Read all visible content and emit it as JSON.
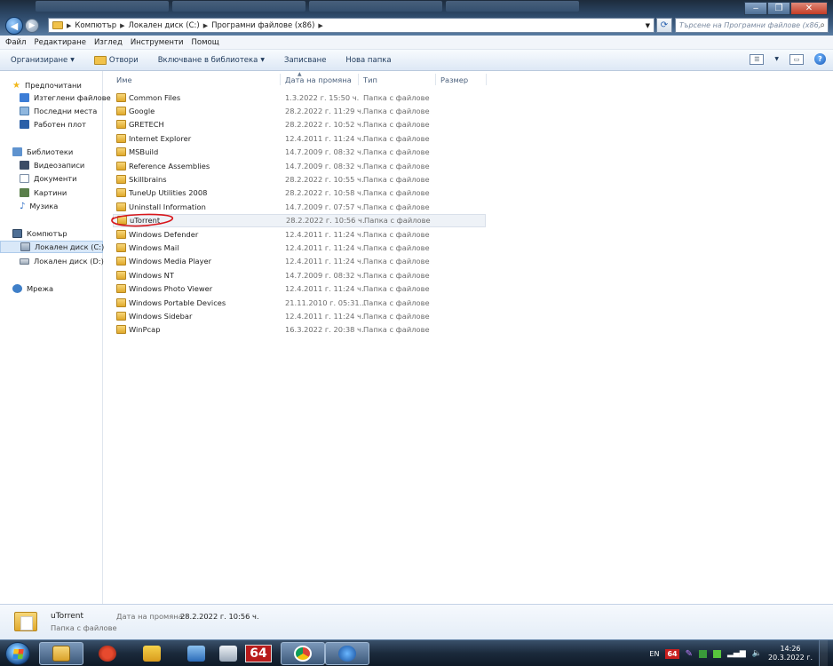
{
  "address": {
    "crumbs": [
      "Компютър",
      "Локален диск (C:)",
      "Програмни файлове (x86)"
    ]
  },
  "search": {
    "placeholder": "Търсене на Програмни файлове (x86)"
  },
  "menu": [
    "Файл",
    "Редактиране",
    "Изглед",
    "Инструменти",
    "Помощ"
  ],
  "commands": {
    "organize": "Организиране",
    "open": "Отвори",
    "include": "Включване в библиотека",
    "burn": "Записване",
    "new_folder": "Нова папка"
  },
  "sidebar": {
    "favorites": "Предпочитани",
    "downloads": "Изтеглени файлове",
    "recent": "Последни места",
    "desktop": "Работен плот",
    "libraries": "Библиотеки",
    "videos": "Видеозаписи",
    "documents": "Документи",
    "pictures": "Картини",
    "music": "Музика",
    "computer": "Компютър",
    "drive_c": "Локален диск (C:)",
    "drive_d": "Локален диск (D:)",
    "network": "Мрежа"
  },
  "columns": {
    "name": "Име",
    "date": "Дата на промяна",
    "type": "Тип",
    "size": "Размер"
  },
  "files": [
    {
      "name": "Common Files",
      "date": "1.3.2022 г. 15:50 ч.",
      "type": "Папка с файлове"
    },
    {
      "name": "Google",
      "date": "28.2.2022 г. 11:29 ч.",
      "type": "Папка с файлове"
    },
    {
      "name": "GRETECH",
      "date": "28.2.2022 г. 10:52 ч.",
      "type": "Папка с файлове"
    },
    {
      "name": "Internet Explorer",
      "date": "12.4.2011 г. 11:24 ч.",
      "type": "Папка с файлове"
    },
    {
      "name": "MSBuild",
      "date": "14.7.2009 г. 08:32 ч.",
      "type": "Папка с файлове"
    },
    {
      "name": "Reference Assemblies",
      "date": "14.7.2009 г. 08:32 ч.",
      "type": "Папка с файлове"
    },
    {
      "name": "Skillbrains",
      "date": "28.2.2022 г. 10:55 ч.",
      "type": "Папка с файлове"
    },
    {
      "name": "TuneUp Utilities 2008",
      "date": "28.2.2022 г. 10:58 ч.",
      "type": "Папка с файлове"
    },
    {
      "name": "Uninstall Information",
      "date": "14.7.2009 г. 07:57 ч.",
      "type": "Папка с файлове"
    },
    {
      "name": "uTorrent",
      "date": "28.2.2022 г. 10:56 ч.",
      "type": "Папка с файлове"
    },
    {
      "name": "Windows Defender",
      "date": "12.4.2011 г. 11:24 ч.",
      "type": "Папка с файлове"
    },
    {
      "name": "Windows Mail",
      "date": "12.4.2011 г. 11:24 ч.",
      "type": "Папка с файлове"
    },
    {
      "name": "Windows Media Player",
      "date": "12.4.2011 г. 11:24 ч.",
      "type": "Папка с файлове"
    },
    {
      "name": "Windows NT",
      "date": "14.7.2009 г. 08:32 ч.",
      "type": "Папка с файлове"
    },
    {
      "name": "Windows Photo Viewer",
      "date": "12.4.2011 г. 11:24 ч.",
      "type": "Папка с файлове"
    },
    {
      "name": "Windows Portable Devices",
      "date": "21.11.2010 г. 05:31...",
      "type": "Папка с файлове"
    },
    {
      "name": "Windows Sidebar",
      "date": "12.4.2011 г. 11:24 ч.",
      "type": "Папка с файлове"
    },
    {
      "name": "WinPcap",
      "date": "16.3.2022 г. 20:38 ч.",
      "type": "Папка с файлове"
    }
  ],
  "details": {
    "name": "uTorrent",
    "type": "Папка с файлове",
    "date_label": "Дата на промяна:",
    "date_value": "28.2.2022 г. 10:56 ч."
  },
  "tray": {
    "lang": "EN",
    "badge": "64",
    "time": "14:26",
    "date": "20.3.2022 г."
  },
  "taskbar": {
    "badge": "64"
  },
  "colors": {
    "annotation": "#d8161b",
    "folder": "#f1c24a",
    "selection": "#d9e8f8"
  }
}
